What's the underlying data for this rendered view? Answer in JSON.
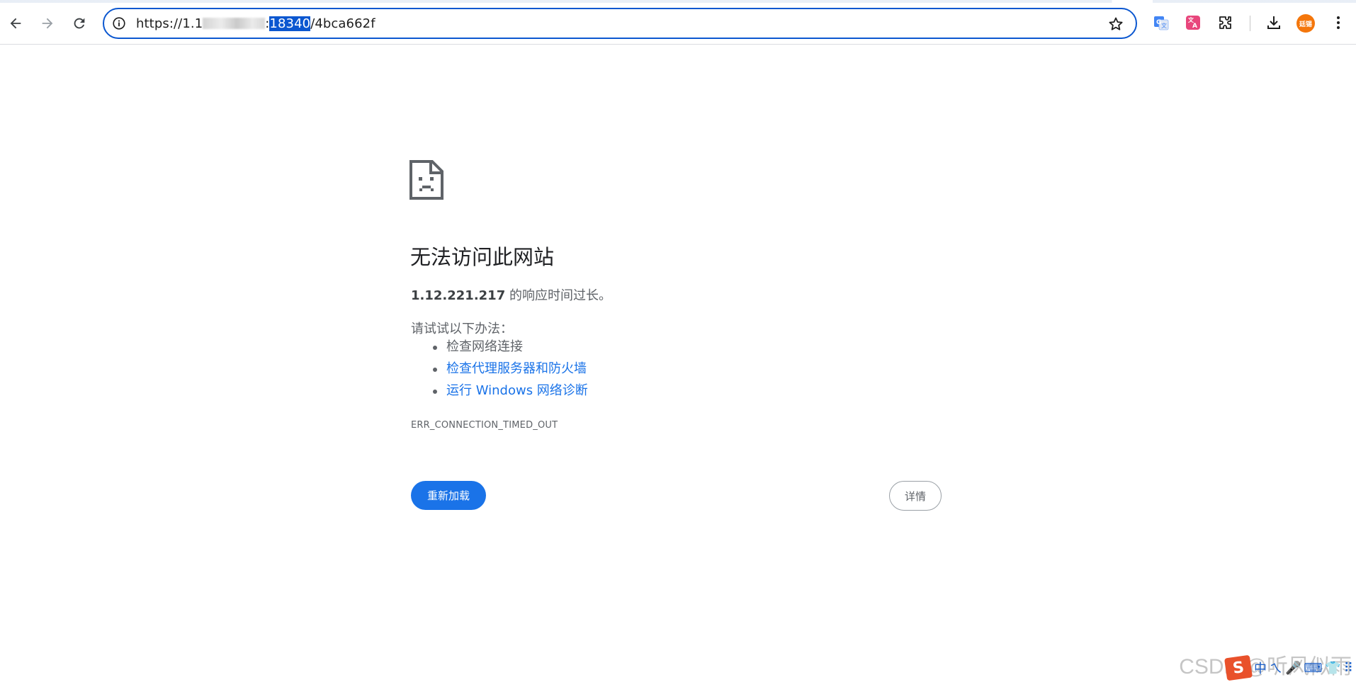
{
  "browser": {
    "url_prefix": "https://1.1",
    "url_colon": ":",
    "url_port_selected": "18340",
    "url_path": "/4bca662f",
    "avatar_text": "廷锡"
  },
  "icons": {
    "back": "arrow-left-icon",
    "forward": "arrow-right-icon",
    "reload": "refresh-icon",
    "site_info": "info-circle-icon",
    "bookmark": "star-icon",
    "translate_ext": "google-translate-icon",
    "translate_ext2": "translate-pink-icon",
    "extensions": "puzzle-icon",
    "downloads": "download-icon",
    "menu": "kebab-menu-icon",
    "sad_page": "sad-document-icon"
  },
  "error": {
    "title": "无法访问此网站",
    "host": "1.12.221.217",
    "detail_suffix": " 的响应时间过长。",
    "suggest_title": "请试试以下办法：",
    "suggestions": [
      "检查网络连接",
      "检查代理服务器和防火墙",
      "运行 Windows 网络诊断"
    ],
    "code": "ERR_CONNECTION_TIMED_OUT",
    "reload_label": "重新加载",
    "details_label": "详情"
  },
  "overlay": {
    "watermark": "CSDN @听风似雨",
    "ime_s": "S",
    "ime_items": [
      "中",
      "ㄟ",
      "🎤",
      "⌨",
      "👕",
      "⠿"
    ]
  },
  "colors": {
    "accent": "#1a73e8",
    "omnibox_border": "#0b57d0",
    "text_secondary": "#5f6368",
    "avatar_bg": "#f4760b"
  }
}
